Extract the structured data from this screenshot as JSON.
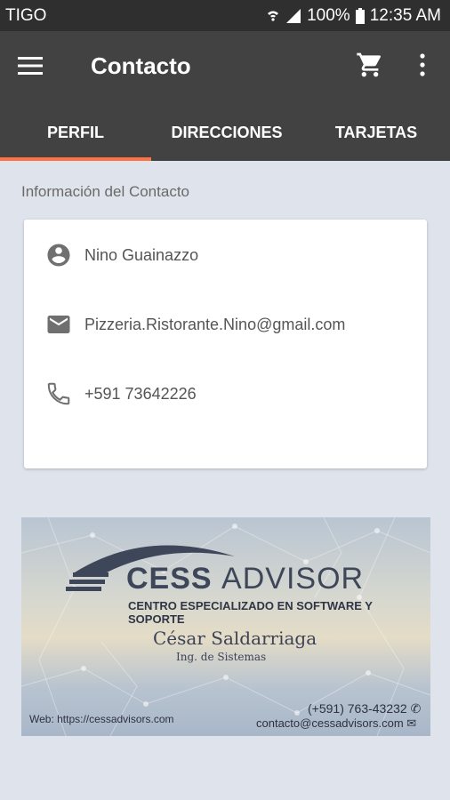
{
  "status_bar": {
    "carrier": "TIGO",
    "battery": "100%",
    "time": "12:35 AM"
  },
  "app_bar": {
    "title": "Contacto",
    "icons": [
      "menu-icon",
      "cart-icon",
      "more-vert-icon"
    ]
  },
  "tabs": [
    {
      "label": "PERFIL",
      "selected": true
    },
    {
      "label": "DIRECCIONES",
      "selected": false
    },
    {
      "label": "TARJETAS",
      "selected": false
    }
  ],
  "colors": {
    "app_bar": "#424242",
    "status_bar": "#2f2f2f",
    "tab_indicator": "#ff7043",
    "background": "#dfe3ec"
  },
  "section_title": "Información del Contacto",
  "contact": {
    "name": "Nino Guainazzo",
    "email": "Pizzeria.Ristorante.Nino@gmail.com",
    "phone": "+591 73642226"
  },
  "business_card": {
    "brand_bold": "CESS",
    "brand_light": "ADVISOR",
    "tagline": "CENTRO ESPECIALIZADO EN SOFTWARE Y SOPORTE",
    "person": "César Saldarriaga",
    "role": "Ing. de Sistemas",
    "web": "Web: https://cessadvisors.com",
    "phone": "(+591) 763-43232",
    "email": "contacto@cessadvisors.com"
  }
}
